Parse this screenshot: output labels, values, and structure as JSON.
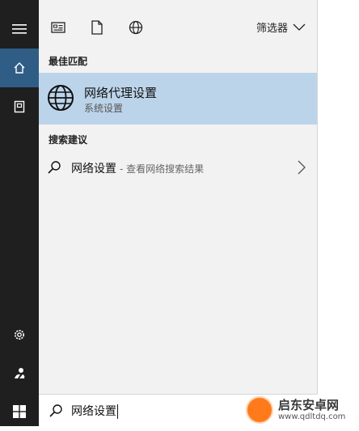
{
  "panel": {
    "filter_label": "筛选器",
    "best_match_heading": "最佳匹配",
    "best_match": {
      "title": "网络代理设置",
      "subtitle": "系统设置"
    },
    "suggestions_heading": "搜索建议",
    "suggestion": {
      "text": "网络设置",
      "hint": "- 查看网络搜索结果"
    }
  },
  "search": {
    "query": "网络设置"
  },
  "watermark": {
    "title": "启东安卓网",
    "url": "www.qdltdq.com"
  },
  "colors": {
    "rail": "#1f1f1f",
    "rail_active": "#2f5d85",
    "highlight": "#bcd4ea",
    "panel": "#f2f2f2"
  },
  "icons": [
    "menu-icon",
    "home-icon",
    "notebook-icon",
    "settings-icon",
    "user-icon",
    "windows-icon",
    "apps-filter-icon",
    "documents-filter-icon",
    "web-filter-icon",
    "globe-icon",
    "search-icon",
    "chevron-right-icon",
    "chevron-down-icon"
  ]
}
